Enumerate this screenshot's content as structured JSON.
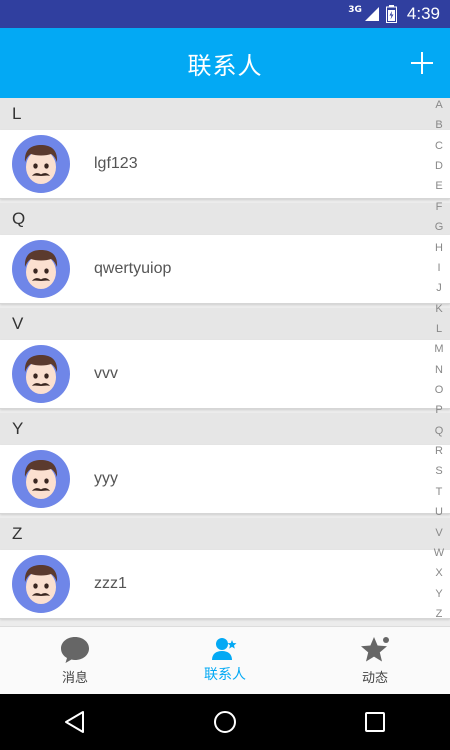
{
  "status_bar": {
    "network": "3G",
    "time": "4:39"
  },
  "header": {
    "title": "联系人"
  },
  "sections": [
    {
      "letter": "L",
      "contacts": [
        {
          "name": "lgf123"
        }
      ]
    },
    {
      "letter": "Q",
      "contacts": [
        {
          "name": "qwertyuiop"
        }
      ]
    },
    {
      "letter": "V",
      "contacts": [
        {
          "name": "vvv"
        }
      ]
    },
    {
      "letter": "Y",
      "contacts": [
        {
          "name": "yyy"
        }
      ]
    },
    {
      "letter": "Z",
      "contacts": [
        {
          "name": "zzz1"
        }
      ]
    }
  ],
  "alphabet": [
    "A",
    "B",
    "C",
    "D",
    "E",
    "F",
    "G",
    "H",
    "I",
    "J",
    "K",
    "L",
    "M",
    "N",
    "O",
    "P",
    "Q",
    "R",
    "S",
    "T",
    "U",
    "V",
    "W",
    "X",
    "Y",
    "Z"
  ],
  "bottom_nav": {
    "items": [
      {
        "label": "消息",
        "icon": "chat-bubble-icon",
        "active": false
      },
      {
        "label": "联系人",
        "icon": "contacts-icon",
        "active": true
      },
      {
        "label": "动态",
        "icon": "star-icon",
        "active": false
      }
    ]
  },
  "colors": {
    "status_bar": "#303F9F",
    "header": "#03A9F4",
    "accent": "#03A9F4",
    "avatar_bg": "#6F86E8"
  }
}
